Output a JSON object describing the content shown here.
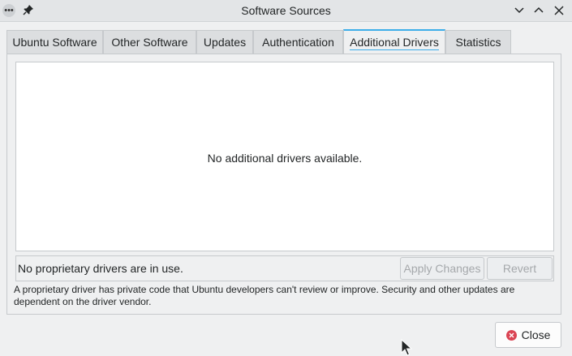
{
  "window": {
    "title": "Software Sources",
    "menu_glyph": "•••"
  },
  "tabs": [
    {
      "label": "Ubuntu Software",
      "active": false
    },
    {
      "label": "Other Software",
      "active": false
    },
    {
      "label": "Updates",
      "active": false
    },
    {
      "label": "Authentication",
      "active": false
    },
    {
      "label": "Additional Drivers",
      "active": true
    },
    {
      "label": "Statistics",
      "active": false
    }
  ],
  "drivers": {
    "empty_message": "No additional drivers available.",
    "status_text": "No proprietary drivers are in use.",
    "apply_label": "Apply Changes",
    "revert_label": "Revert",
    "info_text": "A proprietary driver has private code that Ubuntu developers can't review or improve. Security and other updates are dependent on the driver vendor."
  },
  "footer": {
    "close_label": "Close"
  },
  "colors": {
    "accent": "#3daee9",
    "close_icon": "#da4453"
  }
}
